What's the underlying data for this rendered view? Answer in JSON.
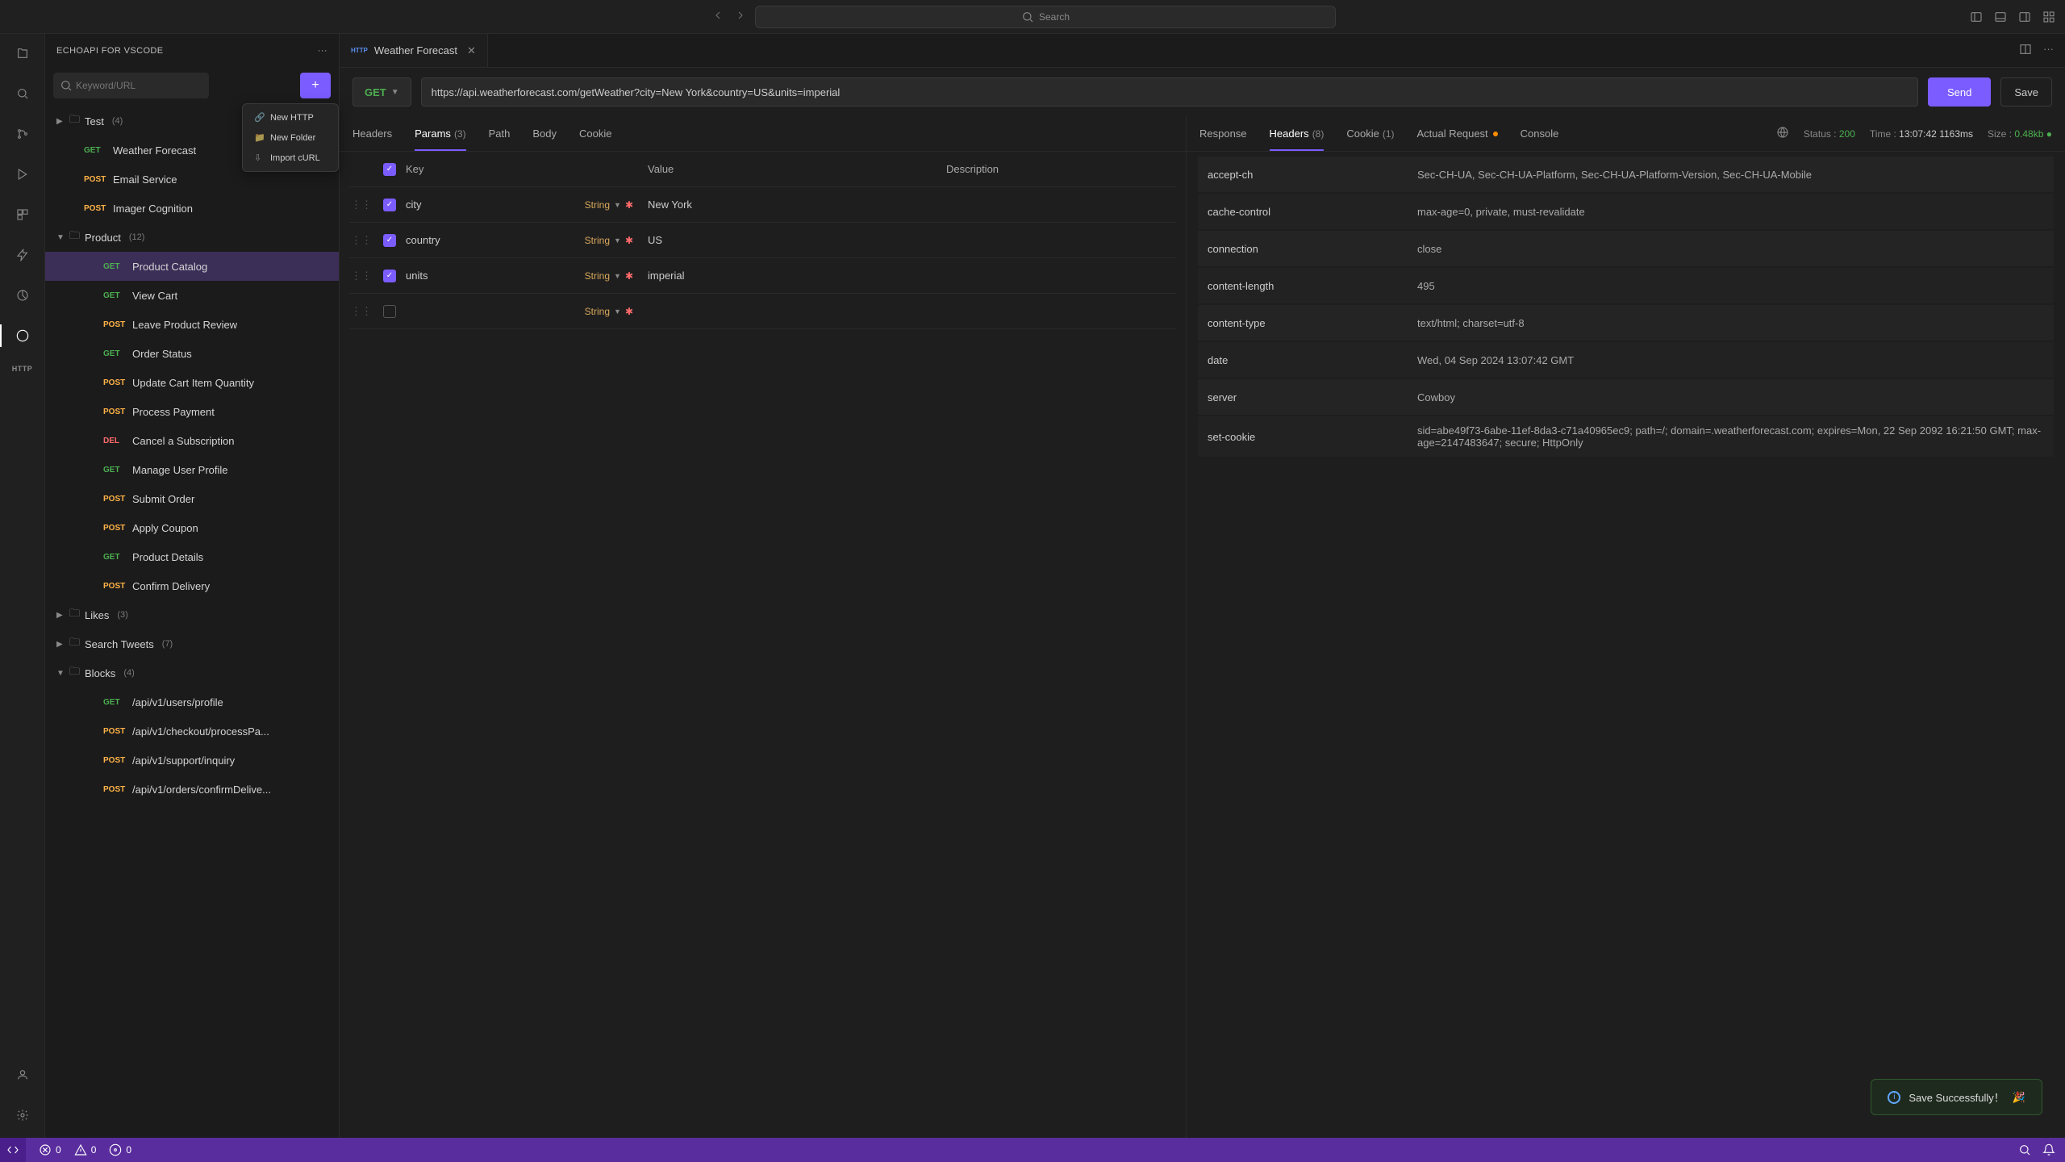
{
  "titlebar": {
    "search_placeholder": "Search"
  },
  "sidebar": {
    "title": "ECHOAPI FOR VSCODE",
    "search_placeholder": "Keyword/URL"
  },
  "context_menu": {
    "new_http": "New HTTP",
    "new_folder": "New Folder",
    "import_curl": "Import cURL"
  },
  "tree": {
    "test": {
      "name": "Test",
      "count": "(4)"
    },
    "weather": {
      "method": "GET",
      "name": "Weather Forecast"
    },
    "email": {
      "method": "POST",
      "name": "Email Service"
    },
    "imager": {
      "method": "POST",
      "name": "Imager Cognition"
    },
    "product": {
      "name": "Product",
      "count": "(12)"
    },
    "p_catalog": {
      "method": "GET",
      "name": "Product Catalog"
    },
    "p_viewcart": {
      "method": "GET",
      "name": "View Cart"
    },
    "p_review": {
      "method": "POST",
      "name": "Leave Product Review"
    },
    "p_orderstatus": {
      "method": "GET",
      "name": "Order Status"
    },
    "p_updatecart": {
      "method": "POST",
      "name": "Update Cart Item Quantity"
    },
    "p_payment": {
      "method": "POST",
      "name": "Process Payment"
    },
    "p_cancel": {
      "method": "DEL",
      "name": "Cancel a Subscription"
    },
    "p_profile": {
      "method": "GET",
      "name": "Manage User Profile"
    },
    "p_submit": {
      "method": "POST",
      "name": "Submit Order"
    },
    "p_coupon": {
      "method": "POST",
      "name": "Apply Coupon"
    },
    "p_details": {
      "method": "GET",
      "name": "Product Details"
    },
    "p_confirm": {
      "method": "POST",
      "name": "Confirm Delivery"
    },
    "likes": {
      "name": "Likes",
      "count": "(3)"
    },
    "tweets": {
      "name": "Search Tweets",
      "count": "(7)"
    },
    "blocks": {
      "name": "Blocks",
      "count": "(4)"
    },
    "b_profile": {
      "method": "GET",
      "name": "/api/v1/users/profile"
    },
    "b_checkout": {
      "method": "POST",
      "name": "/api/v1/checkout/processPa..."
    },
    "b_support": {
      "method": "POST",
      "name": "/api/v1/support/inquiry"
    },
    "b_orders": {
      "method": "POST",
      "name": "/api/v1/orders/confirmDelive..."
    }
  },
  "tab": {
    "title": "Weather Forecast",
    "http_badge": "HTTP"
  },
  "request": {
    "method": "GET",
    "url": "https://api.weatherforecast.com/getWeather?city=New York&country=US&units=imperial",
    "send": "Send",
    "save": "Save"
  },
  "req_tabs": {
    "headers": "Headers",
    "params": "Params",
    "params_count": "(3)",
    "path": "Path",
    "body": "Body",
    "cookie": "Cookie"
  },
  "param_table": {
    "h_key": "Key",
    "h_value": "Value",
    "h_desc": "Description",
    "type": "String",
    "rows": [
      {
        "key": "city",
        "value": "New York"
      },
      {
        "key": "country",
        "value": "US"
      },
      {
        "key": "units",
        "value": "imperial"
      }
    ]
  },
  "res_tabs": {
    "response": "Response",
    "headers": "Headers",
    "headers_count": "(8)",
    "cookie": "Cookie",
    "cookie_count": "(1)",
    "actual": "Actual Request",
    "console": "Console"
  },
  "status": {
    "status_lbl": "Status :",
    "status_val": "200",
    "time_lbl": "Time :",
    "time_val1": "13:07:42",
    "time_val2": "1163ms",
    "size_lbl": "Size :",
    "size_val": "0.48kb"
  },
  "res_headers": [
    {
      "k": "accept-ch",
      "v": "Sec-CH-UA, Sec-CH-UA-Platform, Sec-CH-UA-Platform-Version, Sec-CH-UA-Mobile"
    },
    {
      "k": "cache-control",
      "v": "max-age=0, private, must-revalidate"
    },
    {
      "k": "connection",
      "v": "close"
    },
    {
      "k": "content-length",
      "v": "495"
    },
    {
      "k": "content-type",
      "v": "text/html; charset=utf-8"
    },
    {
      "k": "date",
      "v": "Wed, 04 Sep 2024 13:07:42 GMT"
    },
    {
      "k": "server",
      "v": "Cowboy"
    },
    {
      "k": "set-cookie",
      "v": "sid=abe49f73-6abe-11ef-8da3-c71a40965ec9; path=/; domain=.weatherforecast.com; expires=Mon, 22 Sep 2092 16:21:50 GMT; max-age=2147483647; secure; HttpOnly"
    }
  ],
  "toast": {
    "msg": "Save Successfully！",
    "emoji": "🎉"
  },
  "statusbar": {
    "errors": "0",
    "warnings": "0",
    "ports": "0"
  }
}
